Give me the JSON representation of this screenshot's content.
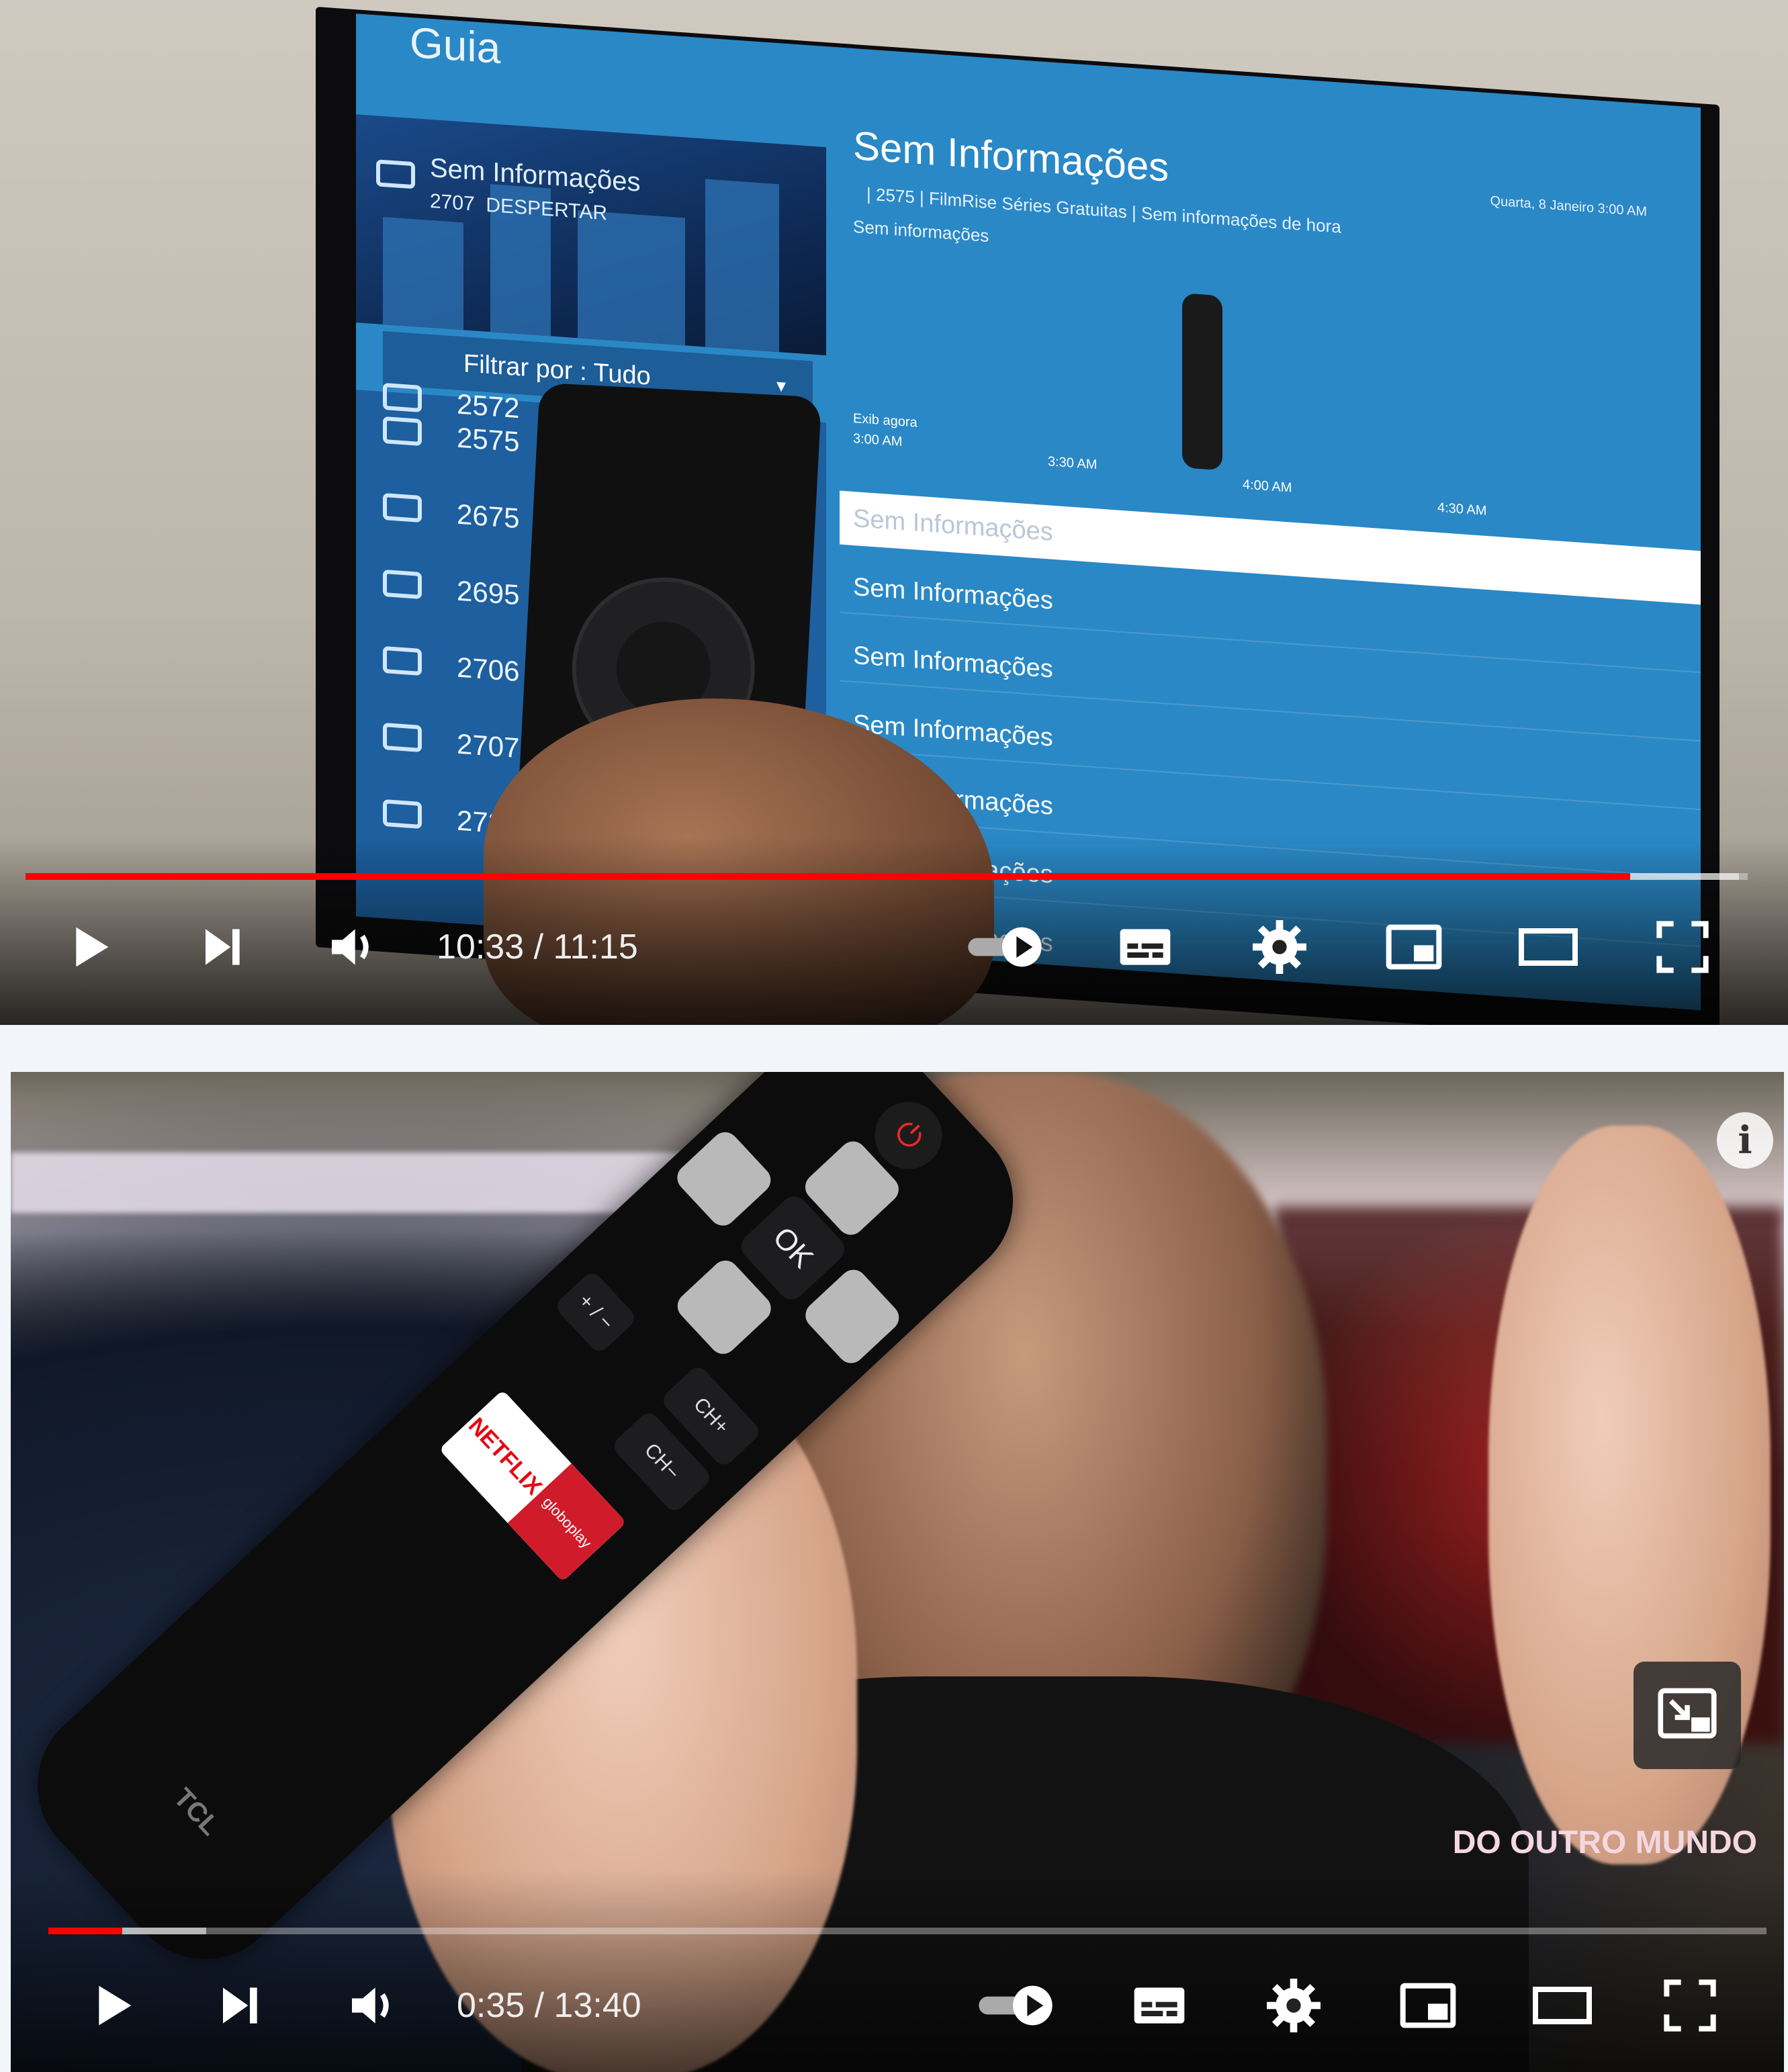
{
  "player1": {
    "tv": {
      "guide_title": "Guia",
      "now_program": "Sem Informações",
      "now_channel": "2707",
      "now_channel_name": "DESPERTAR",
      "filter_label": "Filtrar por : Tudo",
      "info_title": "Sem Informações",
      "info_line": "| 2575 | FilmRise Séries Gratuitas | Sem informações de hora",
      "info_sub": "Sem informações",
      "info_date": "Quarta, 8 Janeiro 3:00 AM",
      "now_header": "Exib agora",
      "time_labels": [
        "3:00 AM",
        "3:30 AM",
        "4:00 AM",
        "4:30 AM"
      ],
      "channels": [
        "2572",
        "2575",
        "2675",
        "2695",
        "2706",
        "2707",
        "2730"
      ],
      "programs": [
        "Sem Informações",
        "Sem Informações",
        "Sem Informações",
        "Sem Informações",
        "Sem Informações",
        "Sem Informações",
        "Sem Informações",
        "Sem Informações"
      ]
    },
    "progress": {
      "played": 0.9316,
      "buffered": 0.995
    },
    "time_display": "10:33 / 11:15"
  },
  "player2": {
    "remote": {
      "ok_label": "OK",
      "ch_plus": "CH+",
      "ch_minus": "CH−",
      "netflix": "NETFLIX",
      "globoplay": "globoplay",
      "brand": "TCL"
    },
    "watermark": "DO OUTRO MUNDO",
    "info_glyph": "i",
    "progress": {
      "played": 0.043,
      "buffered": 0.092
    },
    "time_display": "0:35 / 13:40"
  },
  "icons": [
    "play-icon",
    "next-icon",
    "volume-icon",
    "autoplay-toggle-icon",
    "subtitles-icon",
    "settings-icon",
    "miniplayer-icon",
    "theater-icon",
    "fullscreen-icon",
    "info-icon",
    "expand-icon"
  ],
  "colors": {
    "progress_played": "#ff0000",
    "guide_blue": "#2a88c6"
  }
}
